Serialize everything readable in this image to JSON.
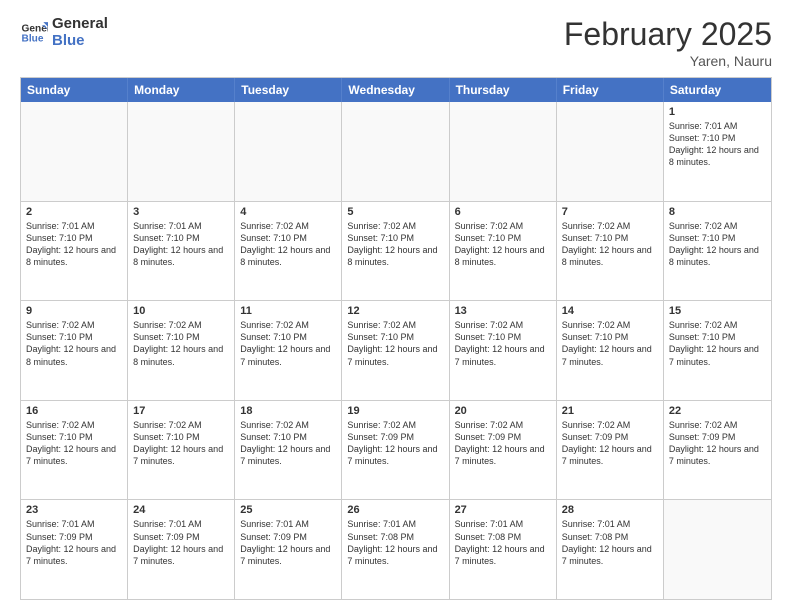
{
  "logo": {
    "line1": "General",
    "line2": "Blue"
  },
  "title": "February 2025",
  "location": "Yaren, Nauru",
  "days_of_week": [
    "Sunday",
    "Monday",
    "Tuesday",
    "Wednesday",
    "Thursday",
    "Friday",
    "Saturday"
  ],
  "weeks": [
    {
      "cells": [
        {
          "day": "",
          "empty": true
        },
        {
          "day": "",
          "empty": true
        },
        {
          "day": "",
          "empty": true
        },
        {
          "day": "",
          "empty": true
        },
        {
          "day": "",
          "empty": true
        },
        {
          "day": "",
          "empty": true
        },
        {
          "day": "1",
          "sunrise": "7:01 AM",
          "sunset": "7:10 PM",
          "daylight": "12 hours and 8 minutes."
        }
      ]
    },
    {
      "cells": [
        {
          "day": "2",
          "sunrise": "7:01 AM",
          "sunset": "7:10 PM",
          "daylight": "12 hours and 8 minutes."
        },
        {
          "day": "3",
          "sunrise": "7:01 AM",
          "sunset": "7:10 PM",
          "daylight": "12 hours and 8 minutes."
        },
        {
          "day": "4",
          "sunrise": "7:02 AM",
          "sunset": "7:10 PM",
          "daylight": "12 hours and 8 minutes."
        },
        {
          "day": "5",
          "sunrise": "7:02 AM",
          "sunset": "7:10 PM",
          "daylight": "12 hours and 8 minutes."
        },
        {
          "day": "6",
          "sunrise": "7:02 AM",
          "sunset": "7:10 PM",
          "daylight": "12 hours and 8 minutes."
        },
        {
          "day": "7",
          "sunrise": "7:02 AM",
          "sunset": "7:10 PM",
          "daylight": "12 hours and 8 minutes."
        },
        {
          "day": "8",
          "sunrise": "7:02 AM",
          "sunset": "7:10 PM",
          "daylight": "12 hours and 8 minutes."
        }
      ]
    },
    {
      "cells": [
        {
          "day": "9",
          "sunrise": "7:02 AM",
          "sunset": "7:10 PM",
          "daylight": "12 hours and 8 minutes."
        },
        {
          "day": "10",
          "sunrise": "7:02 AM",
          "sunset": "7:10 PM",
          "daylight": "12 hours and 8 minutes."
        },
        {
          "day": "11",
          "sunrise": "7:02 AM",
          "sunset": "7:10 PM",
          "daylight": "12 hours and 7 minutes."
        },
        {
          "day": "12",
          "sunrise": "7:02 AM",
          "sunset": "7:10 PM",
          "daylight": "12 hours and 7 minutes."
        },
        {
          "day": "13",
          "sunrise": "7:02 AM",
          "sunset": "7:10 PM",
          "daylight": "12 hours and 7 minutes."
        },
        {
          "day": "14",
          "sunrise": "7:02 AM",
          "sunset": "7:10 PM",
          "daylight": "12 hours and 7 minutes."
        },
        {
          "day": "15",
          "sunrise": "7:02 AM",
          "sunset": "7:10 PM",
          "daylight": "12 hours and 7 minutes."
        }
      ]
    },
    {
      "cells": [
        {
          "day": "16",
          "sunrise": "7:02 AM",
          "sunset": "7:10 PM",
          "daylight": "12 hours and 7 minutes."
        },
        {
          "day": "17",
          "sunrise": "7:02 AM",
          "sunset": "7:10 PM",
          "daylight": "12 hours and 7 minutes."
        },
        {
          "day": "18",
          "sunrise": "7:02 AM",
          "sunset": "7:10 PM",
          "daylight": "12 hours and 7 minutes."
        },
        {
          "day": "19",
          "sunrise": "7:02 AM",
          "sunset": "7:09 PM",
          "daylight": "12 hours and 7 minutes."
        },
        {
          "day": "20",
          "sunrise": "7:02 AM",
          "sunset": "7:09 PM",
          "daylight": "12 hours and 7 minutes."
        },
        {
          "day": "21",
          "sunrise": "7:02 AM",
          "sunset": "7:09 PM",
          "daylight": "12 hours and 7 minutes."
        },
        {
          "day": "22",
          "sunrise": "7:02 AM",
          "sunset": "7:09 PM",
          "daylight": "12 hours and 7 minutes."
        }
      ]
    },
    {
      "cells": [
        {
          "day": "23",
          "sunrise": "7:01 AM",
          "sunset": "7:09 PM",
          "daylight": "12 hours and 7 minutes."
        },
        {
          "day": "24",
          "sunrise": "7:01 AM",
          "sunset": "7:09 PM",
          "daylight": "12 hours and 7 minutes."
        },
        {
          "day": "25",
          "sunrise": "7:01 AM",
          "sunset": "7:09 PM",
          "daylight": "12 hours and 7 minutes."
        },
        {
          "day": "26",
          "sunrise": "7:01 AM",
          "sunset": "7:08 PM",
          "daylight": "12 hours and 7 minutes."
        },
        {
          "day": "27",
          "sunrise": "7:01 AM",
          "sunset": "7:08 PM",
          "daylight": "12 hours and 7 minutes."
        },
        {
          "day": "28",
          "sunrise": "7:01 AM",
          "sunset": "7:08 PM",
          "daylight": "12 hours and 7 minutes."
        },
        {
          "day": "",
          "empty": true
        }
      ]
    }
  ],
  "labels": {
    "sunrise_prefix": "Sunrise: ",
    "sunset_prefix": "Sunset: ",
    "daylight_prefix": "Daylight: "
  }
}
